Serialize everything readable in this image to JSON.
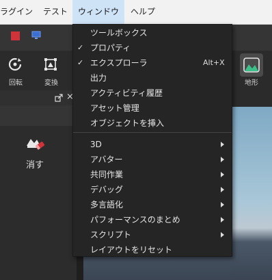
{
  "menubar": {
    "items": [
      {
        "label": "ラグイン"
      },
      {
        "label": "テスト"
      },
      {
        "label": "ウィンドウ"
      },
      {
        "label": "ヘルプ"
      }
    ]
  },
  "ribbon": {
    "rotate_label": "回転",
    "transform_label": "変換",
    "terrain_label": "地形"
  },
  "left_panel": {
    "erase_label": "消す",
    "close_glyph": "×"
  },
  "window_menu": {
    "items": [
      {
        "label": "ツールボックス",
        "checked": false,
        "shortcut": "",
        "submenu": false
      },
      {
        "label": "プロパティ",
        "checked": true,
        "shortcut": "",
        "submenu": false
      },
      {
        "label": "エクスプローラ",
        "checked": true,
        "shortcut": "Alt+X",
        "submenu": false
      },
      {
        "label": "出力",
        "checked": false,
        "shortcut": "",
        "submenu": false
      },
      {
        "label": "アクティビティ履歴",
        "checked": false,
        "shortcut": "",
        "submenu": false
      },
      {
        "label": "アセット管理",
        "checked": false,
        "shortcut": "",
        "submenu": false
      },
      {
        "label": "オブジェクトを挿入",
        "checked": false,
        "shortcut": "",
        "submenu": false
      },
      {
        "label": "3D",
        "checked": false,
        "shortcut": "",
        "submenu": true
      },
      {
        "label": "アバター",
        "checked": false,
        "shortcut": "",
        "submenu": true
      },
      {
        "label": "共同作業",
        "checked": false,
        "shortcut": "",
        "submenu": true
      },
      {
        "label": "デバッグ",
        "checked": false,
        "shortcut": "",
        "submenu": true
      },
      {
        "label": "多言語化",
        "checked": false,
        "shortcut": "",
        "submenu": true
      },
      {
        "label": "パフォーマンスのまとめ",
        "checked": false,
        "shortcut": "",
        "submenu": true
      },
      {
        "label": "スクリプト",
        "checked": false,
        "shortcut": "",
        "submenu": true
      },
      {
        "label": "レイアウトをリセット",
        "checked": false,
        "shortcut": "",
        "submenu": false
      }
    ],
    "check_glyph": "✓"
  },
  "colors": {
    "accent_red": "#d0333a",
    "terrain_green": "#3cc08a",
    "menu_bg": "#252525"
  }
}
